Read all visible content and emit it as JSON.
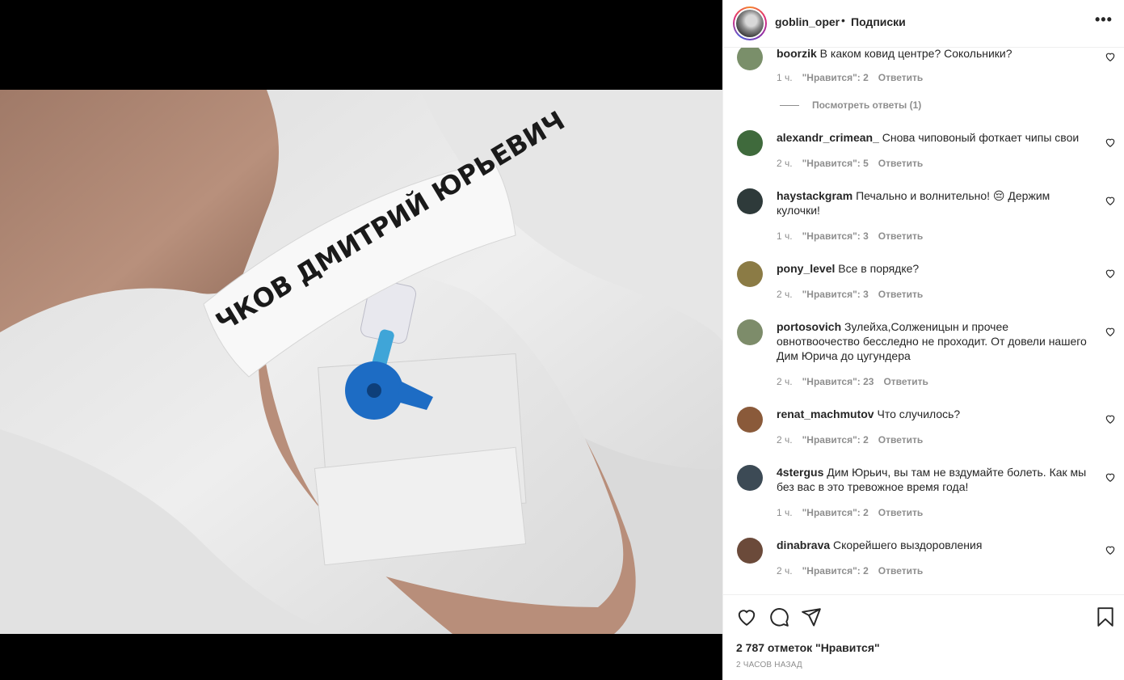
{
  "post": {
    "wristband_text": "ЧКОВ ДМИТРИЙ ЮРЬЕВИЧ"
  },
  "header": {
    "username": "goblin_oper",
    "separator": "•",
    "follow_label": "Подписки",
    "more_icon": "more-horizontal-icon"
  },
  "comments": [
    {
      "user": "boorzik",
      "text": "В каком ковид центре? Сокольники?",
      "time": "1 ч.",
      "likes": "\"Нравится\": 2",
      "reply": "Ответить",
      "avatar_color": "#7a8f6a",
      "view_replies": "Посмотреть ответы (1)"
    },
    {
      "user": "alexandr_crimean_",
      "text": "Снова чиповоный фоткает чипы свои",
      "time": "2 ч.",
      "likes": "\"Нравится\": 5",
      "reply": "Ответить",
      "avatar_color": "#3f6a3c"
    },
    {
      "user": "haystackgram",
      "text": "Печально и волнительно! 😔 Держим кулочки!",
      "time": "1 ч.",
      "likes": "\"Нравится\": 3",
      "reply": "Ответить",
      "avatar_color": "#2e3a3a"
    },
    {
      "user": "pony_level",
      "text": "Все в порядке?",
      "time": "2 ч.",
      "likes": "\"Нравится\": 3",
      "reply": "Ответить",
      "avatar_color": "#8b7b45"
    },
    {
      "user": "portosovich",
      "text": "Зулейха,Солженицын и прочее овнотвоочество бесследно не проходит. От довели нашего Дим Юрича до цугундера",
      "time": "2 ч.",
      "likes": "\"Нравится\": 23",
      "reply": "Ответить",
      "avatar_color": "#7d8c6a"
    },
    {
      "user": "renat_machmutov",
      "text": "Что случилось?",
      "time": "2 ч.",
      "likes": "\"Нравится\": 2",
      "reply": "Ответить",
      "avatar_color": "#8a5a3a"
    },
    {
      "user": "4stergus",
      "text": "Дим Юрьич, вы там не вздумайте болеть. Как мы без вас в это тревожное время года!",
      "time": "1 ч.",
      "likes": "\"Нравится\": 2",
      "reply": "Ответить",
      "avatar_color": "#3c4a55"
    },
    {
      "user": "dinabrava",
      "text": "Скорейшего выздоровления",
      "time": "2 ч.",
      "likes": "\"Нравится\": 2",
      "reply": "Ответить",
      "avatar_color": "#6b4a3a"
    }
  ],
  "actions": {
    "like_icon": "heart-icon",
    "comment_icon": "comment-icon",
    "share_icon": "send-icon",
    "save_icon": "bookmark-icon",
    "likes_count": "2 787 отметок \"Нравится\"",
    "posted_time": "2 ЧАСОВ НАЗАД"
  }
}
